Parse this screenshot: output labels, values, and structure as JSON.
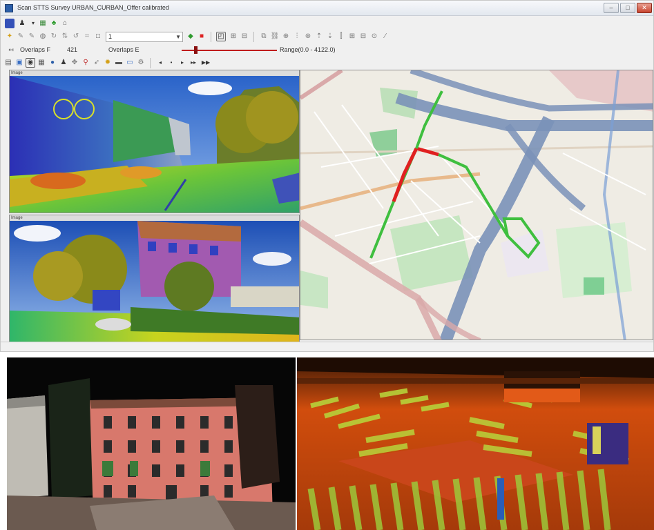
{
  "window": {
    "title": "Scan STTS Survey URBAN_CURBAN_Offer calibrated",
    "controls": [
      "–",
      "□",
      "✕"
    ]
  },
  "toolbar2": {
    "zoom_value": "1"
  },
  "toolbar3": {
    "overlap_label": "Overlaps F",
    "overlap_value": "421",
    "overlap2_label": "Overlaps E",
    "range_label": "Range(0.0 - 4122.0)"
  },
  "viewports": {
    "upper_image_header": "Image",
    "lower_image_header": "Image"
  },
  "colors": {
    "route_green": "#3fbf3f",
    "route_red": "#e02020",
    "range_slider": "#c01c1c",
    "map_highway": "#7a92b8"
  },
  "icons": [
    "floppy-icon",
    "layers-icon",
    "gear-icon",
    "eye-icon",
    "globe-icon",
    "camera-icon",
    "ruler-icon",
    "cursor-icon",
    "play-icon",
    "pan-icon",
    "zoom-icon"
  ]
}
